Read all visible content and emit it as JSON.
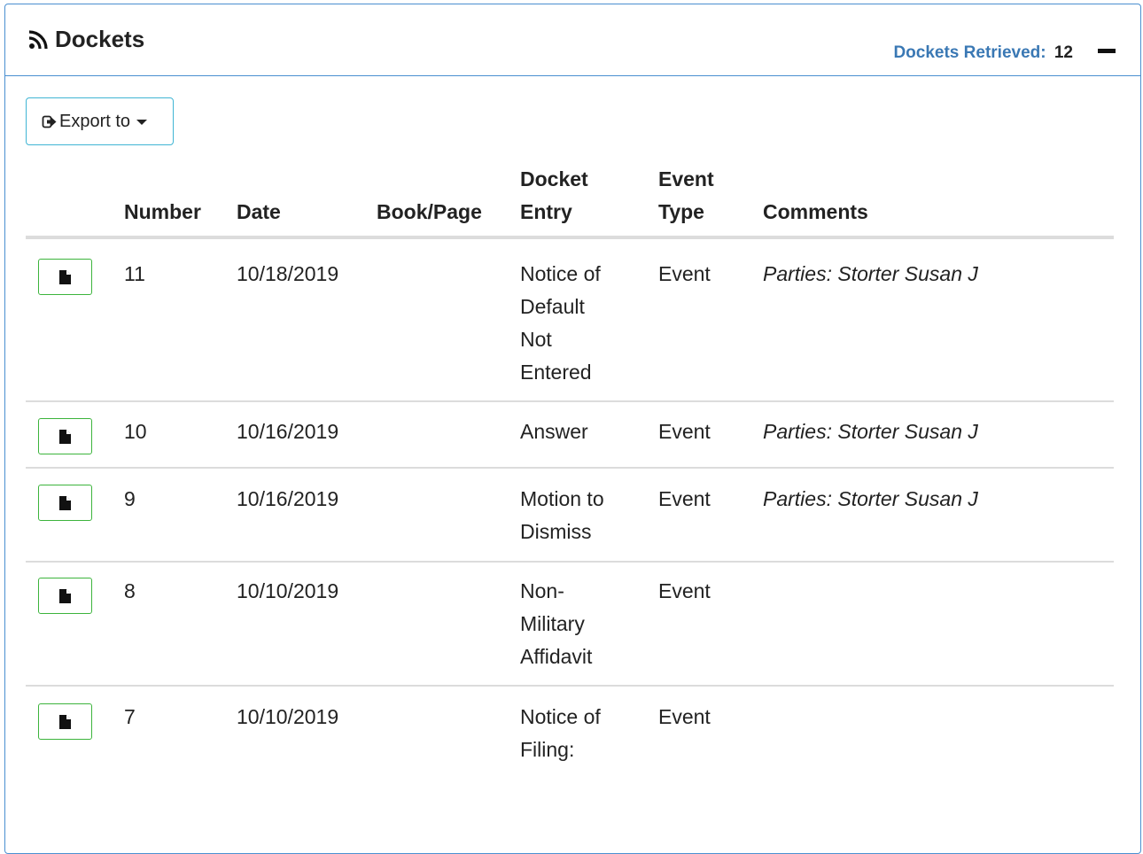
{
  "panel": {
    "title": "Dockets",
    "title_icon": "rss-icon",
    "retrieved_label": "Dockets Retrieved:",
    "retrieved_count": "12",
    "collapse_icon": "minus-icon",
    "border_color": "#4a8fd0"
  },
  "toolbar": {
    "export_label": "Export to",
    "export_icon": "sign-out-icon",
    "dropdown_icon": "caret-down-icon"
  },
  "table": {
    "headers": {
      "number": "Number",
      "date": "Date",
      "book_page": "Book/Page",
      "docket_entry": [
        "Docket",
        "Entry"
      ],
      "event_type": [
        "Event",
        "Type"
      ],
      "comments": "Comments"
    },
    "rows": [
      {
        "number": "11",
        "date": "10/18/2019",
        "book_page": "",
        "entry_lines": [
          "Notice of",
          "Default",
          "Not",
          "Entered"
        ],
        "event_type": "Event",
        "comments": "Parties: Storter Susan J"
      },
      {
        "number": "10",
        "date": "10/16/2019",
        "book_page": "",
        "entry_lines": [
          "Answer"
        ],
        "event_type": "Event",
        "comments": "Parties: Storter Susan J"
      },
      {
        "number": "9",
        "date": "10/16/2019",
        "book_page": "",
        "entry_lines": [
          "Motion to",
          "Dismiss"
        ],
        "event_type": "Event",
        "comments": "Parties: Storter Susan J"
      },
      {
        "number": "8",
        "date": "10/10/2019",
        "book_page": "",
        "entry_lines": [
          "Non-",
          "Military",
          "Affidavit"
        ],
        "event_type": "Event",
        "comments": ""
      },
      {
        "number": "7",
        "date": "10/10/2019",
        "book_page": "",
        "entry_lines": [
          "Notice of",
          "Filing:"
        ],
        "event_type": "Event",
        "comments": ""
      }
    ],
    "row_button_icon": "file-icon",
    "button_border_color": "#3cb43c"
  }
}
